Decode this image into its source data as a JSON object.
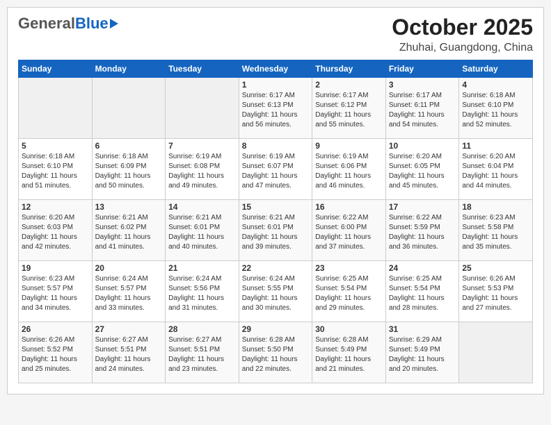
{
  "header": {
    "logo_general": "General",
    "logo_blue": "Blue",
    "month": "October 2025",
    "location": "Zhuhai, Guangdong, China"
  },
  "weekdays": [
    "Sunday",
    "Monday",
    "Tuesday",
    "Wednesday",
    "Thursday",
    "Friday",
    "Saturday"
  ],
  "weeks": [
    [
      {
        "day": "",
        "info": ""
      },
      {
        "day": "",
        "info": ""
      },
      {
        "day": "",
        "info": ""
      },
      {
        "day": "1",
        "info": "Sunrise: 6:17 AM\nSunset: 6:13 PM\nDaylight: 11 hours\nand 56 minutes."
      },
      {
        "day": "2",
        "info": "Sunrise: 6:17 AM\nSunset: 6:12 PM\nDaylight: 11 hours\nand 55 minutes."
      },
      {
        "day": "3",
        "info": "Sunrise: 6:17 AM\nSunset: 6:11 PM\nDaylight: 11 hours\nand 54 minutes."
      },
      {
        "day": "4",
        "info": "Sunrise: 6:18 AM\nSunset: 6:10 PM\nDaylight: 11 hours\nand 52 minutes."
      }
    ],
    [
      {
        "day": "5",
        "info": "Sunrise: 6:18 AM\nSunset: 6:10 PM\nDaylight: 11 hours\nand 51 minutes."
      },
      {
        "day": "6",
        "info": "Sunrise: 6:18 AM\nSunset: 6:09 PM\nDaylight: 11 hours\nand 50 minutes."
      },
      {
        "day": "7",
        "info": "Sunrise: 6:19 AM\nSunset: 6:08 PM\nDaylight: 11 hours\nand 49 minutes."
      },
      {
        "day": "8",
        "info": "Sunrise: 6:19 AM\nSunset: 6:07 PM\nDaylight: 11 hours\nand 47 minutes."
      },
      {
        "day": "9",
        "info": "Sunrise: 6:19 AM\nSunset: 6:06 PM\nDaylight: 11 hours\nand 46 minutes."
      },
      {
        "day": "10",
        "info": "Sunrise: 6:20 AM\nSunset: 6:05 PM\nDaylight: 11 hours\nand 45 minutes."
      },
      {
        "day": "11",
        "info": "Sunrise: 6:20 AM\nSunset: 6:04 PM\nDaylight: 11 hours\nand 44 minutes."
      }
    ],
    [
      {
        "day": "12",
        "info": "Sunrise: 6:20 AM\nSunset: 6:03 PM\nDaylight: 11 hours\nand 42 minutes."
      },
      {
        "day": "13",
        "info": "Sunrise: 6:21 AM\nSunset: 6:02 PM\nDaylight: 11 hours\nand 41 minutes."
      },
      {
        "day": "14",
        "info": "Sunrise: 6:21 AM\nSunset: 6:01 PM\nDaylight: 11 hours\nand 40 minutes."
      },
      {
        "day": "15",
        "info": "Sunrise: 6:21 AM\nSunset: 6:01 PM\nDaylight: 11 hours\nand 39 minutes."
      },
      {
        "day": "16",
        "info": "Sunrise: 6:22 AM\nSunset: 6:00 PM\nDaylight: 11 hours\nand 37 minutes."
      },
      {
        "day": "17",
        "info": "Sunrise: 6:22 AM\nSunset: 5:59 PM\nDaylight: 11 hours\nand 36 minutes."
      },
      {
        "day": "18",
        "info": "Sunrise: 6:23 AM\nSunset: 5:58 PM\nDaylight: 11 hours\nand 35 minutes."
      }
    ],
    [
      {
        "day": "19",
        "info": "Sunrise: 6:23 AM\nSunset: 5:57 PM\nDaylight: 11 hours\nand 34 minutes."
      },
      {
        "day": "20",
        "info": "Sunrise: 6:24 AM\nSunset: 5:57 PM\nDaylight: 11 hours\nand 33 minutes."
      },
      {
        "day": "21",
        "info": "Sunrise: 6:24 AM\nSunset: 5:56 PM\nDaylight: 11 hours\nand 31 minutes."
      },
      {
        "day": "22",
        "info": "Sunrise: 6:24 AM\nSunset: 5:55 PM\nDaylight: 11 hours\nand 30 minutes."
      },
      {
        "day": "23",
        "info": "Sunrise: 6:25 AM\nSunset: 5:54 PM\nDaylight: 11 hours\nand 29 minutes."
      },
      {
        "day": "24",
        "info": "Sunrise: 6:25 AM\nSunset: 5:54 PM\nDaylight: 11 hours\nand 28 minutes."
      },
      {
        "day": "25",
        "info": "Sunrise: 6:26 AM\nSunset: 5:53 PM\nDaylight: 11 hours\nand 27 minutes."
      }
    ],
    [
      {
        "day": "26",
        "info": "Sunrise: 6:26 AM\nSunset: 5:52 PM\nDaylight: 11 hours\nand 25 minutes."
      },
      {
        "day": "27",
        "info": "Sunrise: 6:27 AM\nSunset: 5:51 PM\nDaylight: 11 hours\nand 24 minutes."
      },
      {
        "day": "28",
        "info": "Sunrise: 6:27 AM\nSunset: 5:51 PM\nDaylight: 11 hours\nand 23 minutes."
      },
      {
        "day": "29",
        "info": "Sunrise: 6:28 AM\nSunset: 5:50 PM\nDaylight: 11 hours\nand 22 minutes."
      },
      {
        "day": "30",
        "info": "Sunrise: 6:28 AM\nSunset: 5:49 PM\nDaylight: 11 hours\nand 21 minutes."
      },
      {
        "day": "31",
        "info": "Sunrise: 6:29 AM\nSunset: 5:49 PM\nDaylight: 11 hours\nand 20 minutes."
      },
      {
        "day": "",
        "info": ""
      }
    ]
  ]
}
